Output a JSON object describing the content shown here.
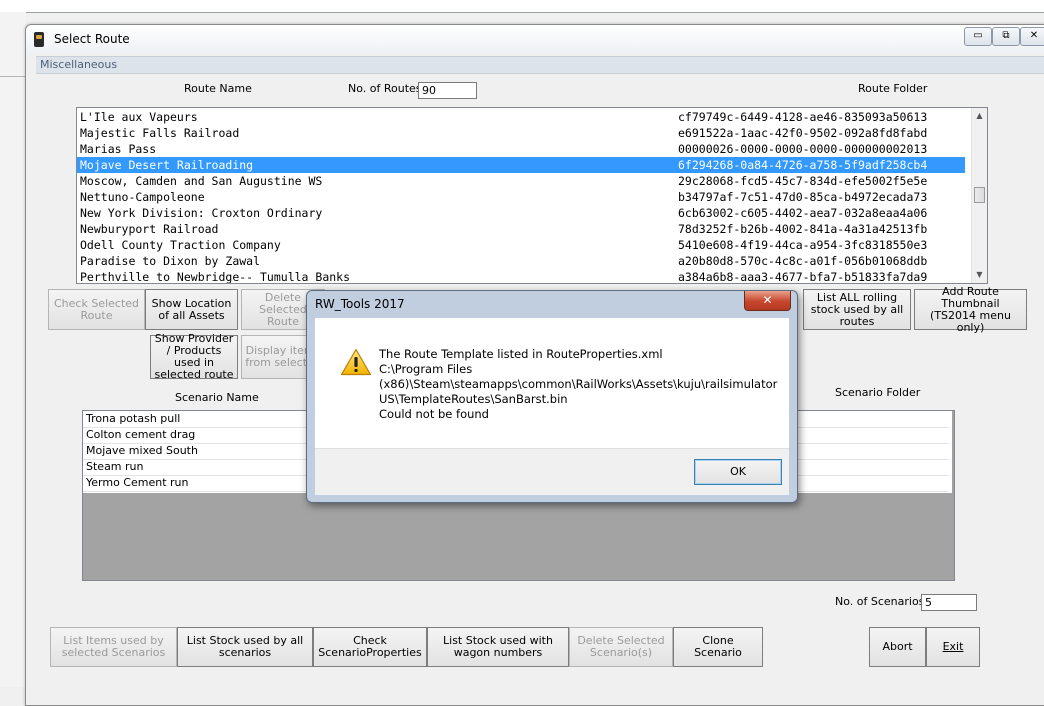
{
  "window": {
    "title": "Select Route",
    "tab": "Miscellaneous",
    "minimize_glyph": "▭",
    "restore_glyph": "⧉",
    "close_glyph": "✕"
  },
  "routes_panel": {
    "route_name_header": "Route Name",
    "num_routes_label": "No. of Routes",
    "num_routes_value": "90",
    "route_folder_header": "Route Folder",
    "rows": [
      {
        "name": "L'Ile aux Vapeurs",
        "folder": "cf79749c-6449-4128-ae46-835093a50613"
      },
      {
        "name": "Majestic Falls Railroad",
        "folder": "e691522a-1aac-42f0-9502-092a8fd8fabd"
      },
      {
        "name": "Marias Pass",
        "folder": "00000026-0000-0000-0000-000000002013"
      },
      {
        "name": "Mojave Desert Railroading",
        "folder": "6f294268-0a84-4726-a758-5f9adf258cb4"
      },
      {
        "name": "Moscow, Camden and San Augustine WS",
        "folder": "29c28068-fcd5-45c7-834d-efe5002f5e5e"
      },
      {
        "name": "Nettuno-Campoleone",
        "folder": "b34797af-7c51-47d0-85ca-b4972ecada73"
      },
      {
        "name": "New York Division: Croxton Ordinary",
        "folder": "6cb63002-c605-4402-aea7-032a8eaa4a06"
      },
      {
        "name": "Newburyport Railroad",
        "folder": "78d3252f-b26b-4002-841a-4a31a42513fb"
      },
      {
        "name": "Odell County Traction Company",
        "folder": "5410e608-4f19-44ca-a954-3fc8318550e3"
      },
      {
        "name": "Paradise to Dixon by Zawal",
        "folder": "a20b80d8-570c-4c8c-a01f-056b01068ddb"
      },
      {
        "name": "Perthville to Newbridge-- Tumulla Banks",
        "folder": "a384a6b8-aaa3-4677-bfa7-b51833fa7da9"
      }
    ],
    "selected_index": 3
  },
  "route_buttons": {
    "check_selected_route": "Check Selected Route",
    "show_location": "Show Location of all Assets",
    "delete_selected_route": "Delete Selected Route",
    "list_all_rolling_stock": "List ALL rolling stock used by all routes",
    "add_route_thumbnail": "Add Route Thumbnail (TS2014 menu only)",
    "show_provider": "Show Provider / Products used in selected route",
    "display_items": "Display items from selected"
  },
  "scenarios_panel": {
    "scenario_name_header": "Scenario Name",
    "scenario_folder_header": "Scenario Folder",
    "rows": [
      "Trona potash pull",
      "Colton cement drag",
      "Mojave mixed South",
      "Steam run",
      "Yermo Cement run"
    ],
    "num_scenarios_label": "No. of Scenarios",
    "num_scenarios_value": "5"
  },
  "bottom_buttons": {
    "list_items": "List Items used by selected Scenarios",
    "list_stock_all": "List Stock used by all scenarios",
    "check_scenario_props": "Check ScenarioProperties",
    "list_stock_wagon": "List Stock used with wagon numbers",
    "delete_scenarios": "Delete Selected Scenario(s)",
    "clone_scenario": "Clone Scenario",
    "abort": "Abort",
    "exit": "Exit"
  },
  "dialog": {
    "title": "RW_Tools 2017",
    "close_glyph": "✕",
    "icon": "warning-icon",
    "message_lines": [
      "The Route Template listed in RouteProperties.xml",
      "C:\\Program Files",
      "(x86)\\Steam\\steamapps\\common\\RailWorks\\Assets\\kuju\\railsimulator",
      "US\\TemplateRoutes\\SanBarst.bin",
      "Could not be found"
    ],
    "ok_label": "OK"
  }
}
